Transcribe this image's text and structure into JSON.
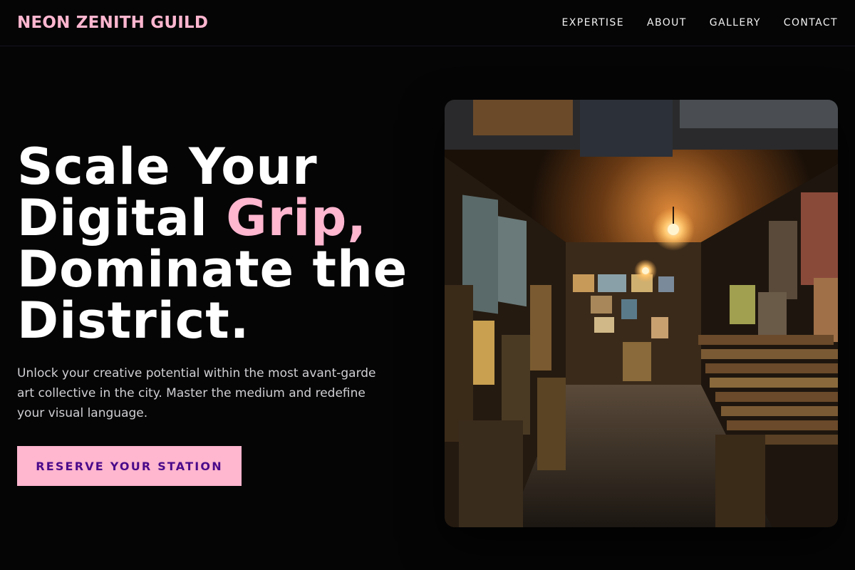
{
  "brand": {
    "name": "NEON ZENITH GUILD"
  },
  "nav": {
    "items": [
      "EXPERTISE",
      "ABOUT",
      "GALLERY",
      "CONTACT"
    ]
  },
  "hero": {
    "line1": "Scale Your",
    "line2_pre": "Digital ",
    "line2_accent": "Grip,",
    "line3": "Dominate the",
    "line4": "District.",
    "subtitle": "Unlock your creative potential within the most avant-garde art collective in the city. Master the medium and redefine your visual language.",
    "cta_label": "RESERVE YOUR STATION"
  },
  "colors": {
    "accent": "#ffb6cf",
    "cta_text": "#4a0a8a",
    "background": "#050506"
  }
}
